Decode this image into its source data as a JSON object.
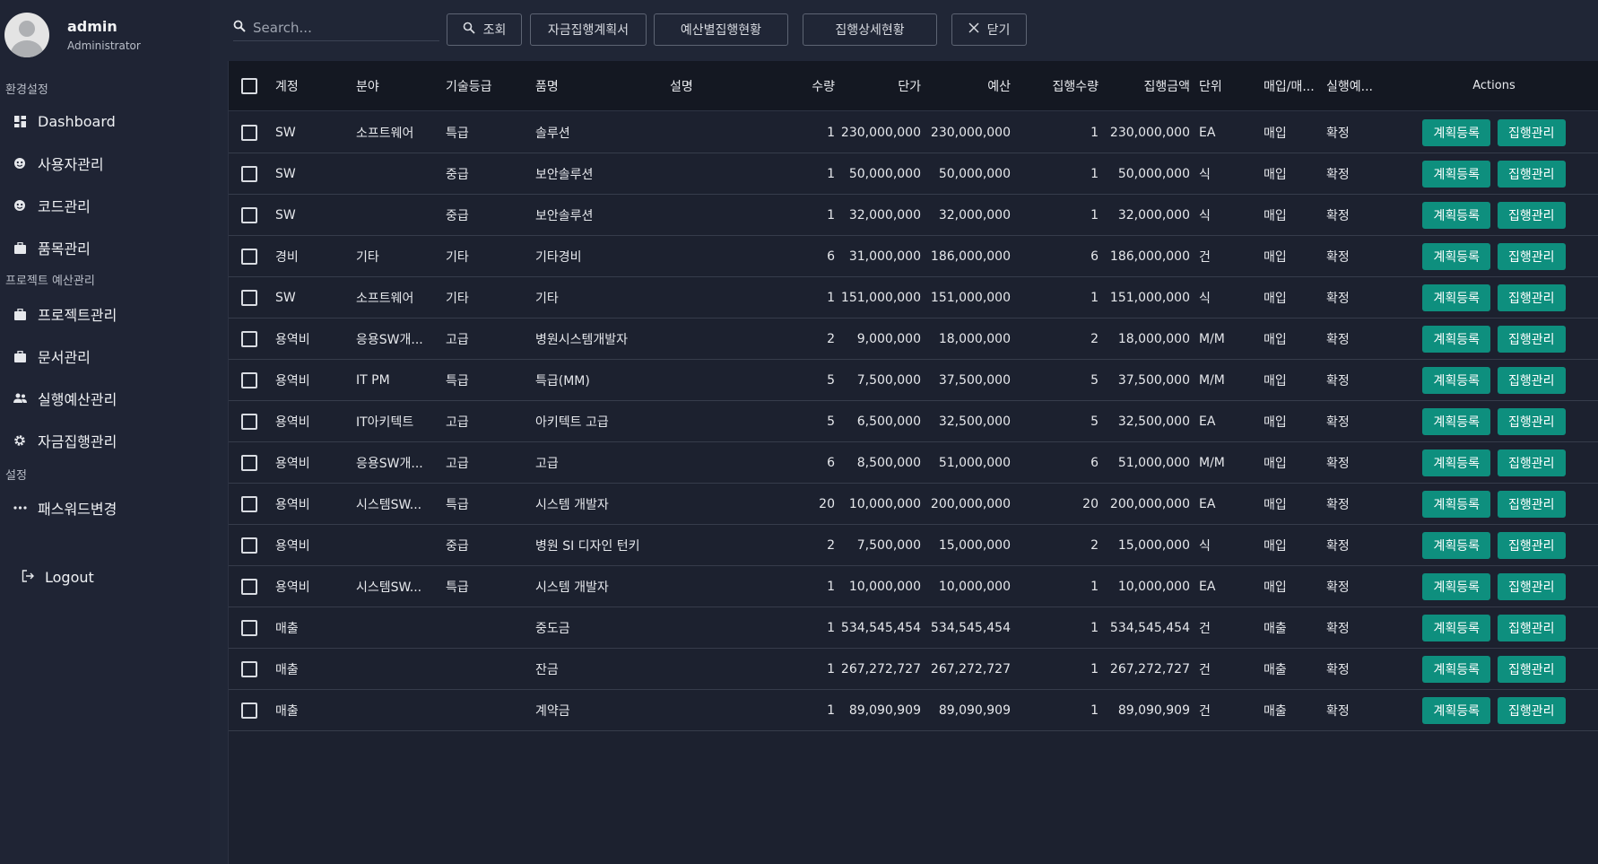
{
  "sidebar": {
    "profile": {
      "name": "admin",
      "role": "Administrator"
    },
    "sections": [
      {
        "label": "환경설정"
      },
      {
        "label": "프로젝트 예산관리"
      },
      {
        "label": "설정"
      }
    ],
    "items": [
      {
        "label": "Dashboard",
        "icon": "dashboard-icon"
      },
      {
        "label": "사용자관리",
        "icon": "face-icon"
      },
      {
        "label": "코드관리",
        "icon": "face-icon"
      },
      {
        "label": "품목관리",
        "icon": "briefcase-icon"
      },
      {
        "label": "프로젝트관리",
        "icon": "briefcase-icon"
      },
      {
        "label": "문서관리",
        "icon": "briefcase-icon"
      },
      {
        "label": "실행예산관리",
        "icon": "people-icon"
      },
      {
        "label": "자금집행관리",
        "icon": "gear-icon"
      },
      {
        "label": "패스워드변경",
        "icon": "password-icon"
      }
    ],
    "logout": "Logout"
  },
  "toolbar": {
    "search_placeholder": "Search...",
    "buttons": [
      {
        "label": "조회",
        "icon": "search-icon"
      },
      {
        "label": "자금집행계획서"
      },
      {
        "label": "예산별집행현황"
      },
      {
        "label": "집행상세현황"
      },
      {
        "label": "닫기",
        "icon": "close-icon"
      }
    ]
  },
  "table": {
    "headers": [
      "계정",
      "분야",
      "기술등급",
      "품명",
      "설명",
      "수량",
      "단가",
      "예산",
      "집행수량",
      "집행금액",
      "단위",
      "매입/매...",
      "실행예...",
      "Actions"
    ],
    "action_labels": {
      "plan": "계획등록",
      "manage": "집행관리"
    },
    "rows": [
      [
        "SW",
        "소프트웨어",
        "특급",
        "솔루션",
        "",
        "1",
        "230,000,000",
        "230,000,000",
        "1",
        "230,000,000",
        "EA",
        "매입",
        "확정"
      ],
      [
        "SW",
        "",
        "중급",
        "보안솔루션",
        "",
        "1",
        "50,000,000",
        "50,000,000",
        "1",
        "50,000,000",
        "식",
        "매입",
        "확정"
      ],
      [
        "SW",
        "",
        "중급",
        "보안솔루션",
        "",
        "1",
        "32,000,000",
        "32,000,000",
        "1",
        "32,000,000",
        "식",
        "매입",
        "확정"
      ],
      [
        "경비",
        "기타",
        "기타",
        "기타경비",
        "",
        "6",
        "31,000,000",
        "186,000,000",
        "6",
        "186,000,000",
        "건",
        "매입",
        "확정"
      ],
      [
        "SW",
        "소프트웨어",
        "기타",
        "기타",
        "",
        "1",
        "151,000,000",
        "151,000,000",
        "1",
        "151,000,000",
        "식",
        "매입",
        "확정"
      ],
      [
        "용역비",
        "응용SW개...",
        "고급",
        "병원시스템개발자",
        "",
        "2",
        "9,000,000",
        "18,000,000",
        "2",
        "18,000,000",
        "M/M",
        "매입",
        "확정"
      ],
      [
        "용역비",
        "IT PM",
        "특급",
        "특급(MM)",
        "",
        "5",
        "7,500,000",
        "37,500,000",
        "5",
        "37,500,000",
        "M/M",
        "매입",
        "확정"
      ],
      [
        "용역비",
        "IT아키텍트",
        "고급",
        "아키텍트 고급",
        "",
        "5",
        "6,500,000",
        "32,500,000",
        "5",
        "32,500,000",
        "EA",
        "매입",
        "확정"
      ],
      [
        "용역비",
        "응용SW개...",
        "고급",
        "고급",
        "",
        "6",
        "8,500,000",
        "51,000,000",
        "6",
        "51,000,000",
        "M/M",
        "매입",
        "확정"
      ],
      [
        "용역비",
        "시스템SW...",
        "특급",
        "시스템 개발자",
        "",
        "20",
        "10,000,000",
        "200,000,000",
        "20",
        "200,000,000",
        "EA",
        "매입",
        "확정"
      ],
      [
        "용역비",
        "",
        "중급",
        "병원 SI 디자인 턴키",
        "",
        "2",
        "7,500,000",
        "15,000,000",
        "2",
        "15,000,000",
        "식",
        "매입",
        "확정"
      ],
      [
        "용역비",
        "시스템SW...",
        "특급",
        "시스템 개발자",
        "",
        "1",
        "10,000,000",
        "10,000,000",
        "1",
        "10,000,000",
        "EA",
        "매입",
        "확정"
      ],
      [
        "매출",
        "",
        "",
        "중도금",
        "",
        "1",
        "534,545,454",
        "534,545,454",
        "1",
        "534,545,454",
        "건",
        "매출",
        "확정"
      ],
      [
        "매출",
        "",
        "",
        "잔금",
        "",
        "1",
        "267,272,727",
        "267,272,727",
        "1",
        "267,272,727",
        "건",
        "매출",
        "확정"
      ],
      [
        "매출",
        "",
        "",
        "계약금",
        "",
        "1",
        "89,090,909",
        "89,090,909",
        "1",
        "89,090,909",
        "건",
        "매출",
        "확정"
      ]
    ]
  },
  "colors": {
    "sidebar_bg": "#1f2434",
    "main_bg": "#202636",
    "header_bg": "#141822",
    "action_btn": "#0e8f7e"
  }
}
